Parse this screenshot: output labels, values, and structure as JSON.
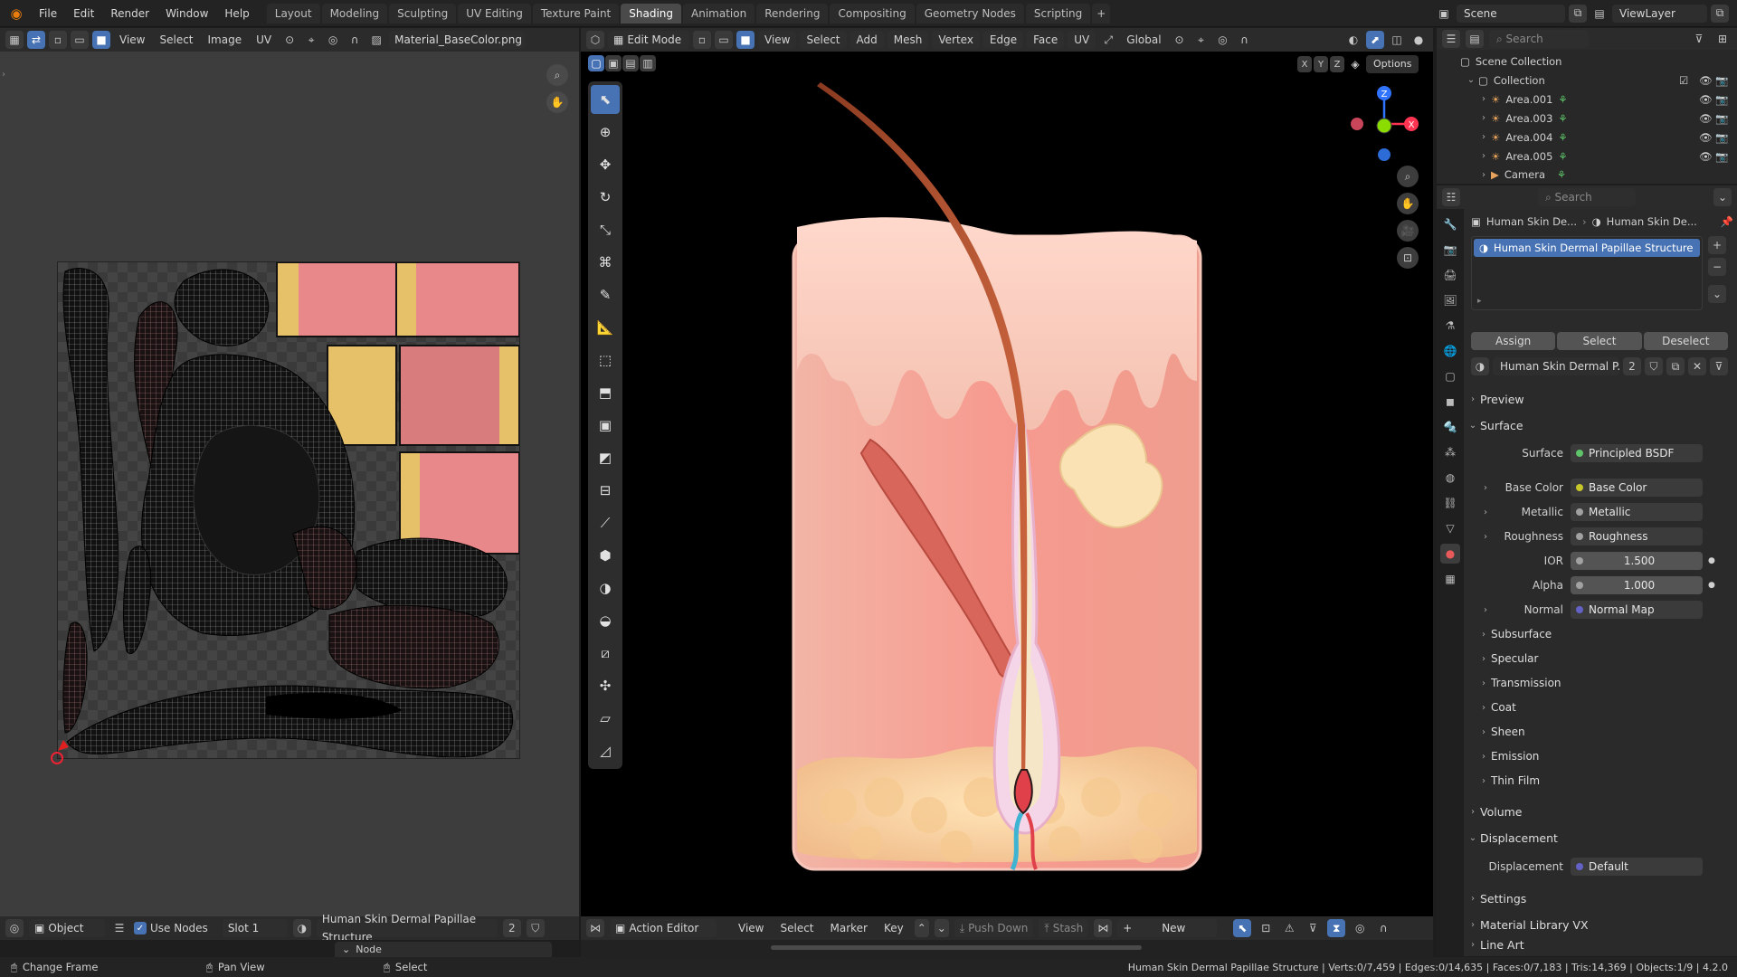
{
  "app": {
    "logo": "blender-logo-icon"
  },
  "menu": [
    "File",
    "Edit",
    "Render",
    "Window",
    "Help"
  ],
  "workspaces": [
    {
      "label": "Layout",
      "active": false
    },
    {
      "label": "Modeling",
      "active": false
    },
    {
      "label": "Sculpting",
      "active": false
    },
    {
      "label": "UV Editing",
      "active": false
    },
    {
      "label": "Texture Paint",
      "active": false
    },
    {
      "label": "Shading",
      "active": true
    },
    {
      "label": "Animation",
      "active": false
    },
    {
      "label": "Rendering",
      "active": false
    },
    {
      "label": "Compositing",
      "active": false
    },
    {
      "label": "Geometry Nodes",
      "active": false
    },
    {
      "label": "Scripting",
      "active": false
    }
  ],
  "add_tab": "+",
  "scene": "Scene",
  "viewlayer": "ViewLayer",
  "image_editor": {
    "menus": [
      "View",
      "Select",
      "Image",
      "UV"
    ],
    "image_name": "Material_BaseColor.png"
  },
  "viewport": {
    "mode": "Edit Mode",
    "menus": [
      "View",
      "Select",
      "Add",
      "Mesh",
      "Vertex",
      "Edge",
      "Face",
      "UV"
    ],
    "transform": "Global",
    "options": "Options",
    "axes": [
      "X",
      "Y",
      "Z"
    ],
    "gizmo": {
      "x": "X",
      "z": "Z"
    }
  },
  "outliner": {
    "search_placeholder": "Search",
    "root": "Scene Collection",
    "collection": "Collection",
    "items": [
      "Area.001",
      "Area.003",
      "Area.004",
      "Area.005",
      "Camera"
    ]
  },
  "properties": {
    "search_placeholder": "Search",
    "breadcrumb": [
      "Human Skin De...",
      "Human Skin De..."
    ],
    "slot_name": "Human Skin Dermal Papillae Structure",
    "assign": "Assign",
    "select": "Select",
    "deselect": "Deselect",
    "material_name": "Human Skin Dermal P...",
    "users": "2",
    "preview": "Preview",
    "surface_section": "Surface",
    "rows": [
      {
        "label": "Surface",
        "value": "Principled BSDF",
        "kind": "link"
      },
      {
        "label": "Base Color",
        "value": "Base Color",
        "kind": "link"
      },
      {
        "label": "Metallic",
        "value": "Metallic",
        "kind": "link"
      },
      {
        "label": "Roughness",
        "value": "Roughness",
        "kind": "link"
      },
      {
        "label": "IOR",
        "value": "1.500",
        "kind": "num"
      },
      {
        "label": "Alpha",
        "value": "1.000",
        "kind": "num"
      },
      {
        "label": "Normal",
        "value": "Normal Map",
        "kind": "link-violet"
      }
    ],
    "subsections": [
      "Subsurface",
      "Specular",
      "Transmission",
      "Coat",
      "Sheen",
      "Emission",
      "Thin Film"
    ],
    "volume": "Volume",
    "displacement_section": "Displacement",
    "displacement_label": "Displacement",
    "displacement_value": "Default",
    "settings": "Settings",
    "library": "Material Library VX",
    "lineart": "Line Art"
  },
  "image_footer": {
    "object": "Object",
    "use_nodes": "Use Nodes",
    "slot": "Slot 1",
    "material": "Human Skin Dermal Papillae Structure",
    "users": "2",
    "node_panel": "Node"
  },
  "action_editor": {
    "mode": "Action Editor",
    "menus": [
      "View",
      "Select",
      "Marker",
      "Key"
    ],
    "push_down": "Push Down",
    "stash": "Stash",
    "new": "New"
  },
  "status": {
    "left": [
      {
        "icon": "mouse-left-icon",
        "label": "Change Frame"
      },
      {
        "icon": "mouse-middle-icon",
        "label": "Pan View"
      },
      {
        "icon": "mouse-right-icon",
        "label": "Select"
      }
    ],
    "stats": "Human Skin Dermal Papillae Structure | Verts:0/7,459 | Edges:0/14,635 | Faces:0/7,183 | Tris:14,369 | Objects:1/9 | 4.2.0"
  }
}
